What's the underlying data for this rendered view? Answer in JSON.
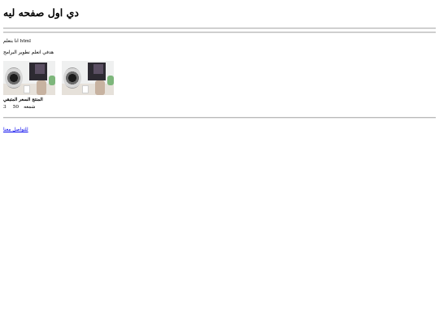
{
  "header": {
    "title": "دي اول صفحه ليه"
  },
  "content": {
    "line1": "انا بتعلم html",
    "line2": "هدفي اتعلم تطوير البرامج"
  },
  "product": {
    "name": "المنتج السعر المتبقي",
    "quantity_label": "شمعه",
    "price": "50",
    "remaining": "3"
  },
  "footer": {
    "contact_link": "للتواصل معنا"
  }
}
